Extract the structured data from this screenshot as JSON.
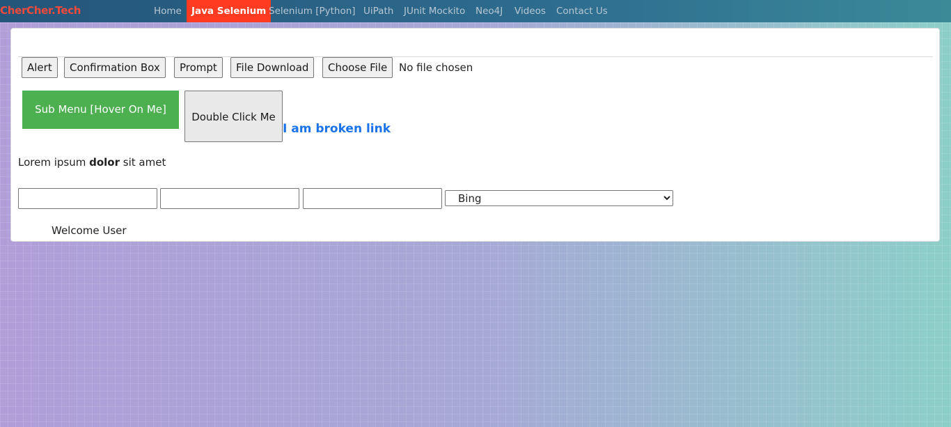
{
  "site": {
    "brand": "CherCher.Tech"
  },
  "nav": {
    "items": [
      {
        "label": "Home",
        "active": false
      },
      {
        "label": "Java Selenium",
        "active": true
      },
      {
        "label": "Selenium [Python]",
        "active": false
      },
      {
        "label": "UiPath",
        "active": false
      },
      {
        "label": "JUnit Mockito",
        "active": false
      },
      {
        "label": "Neo4J",
        "active": false
      },
      {
        "label": "Videos",
        "active": false
      },
      {
        "label": "Contact Us",
        "active": false
      }
    ]
  },
  "buttons": {
    "alert": "Alert",
    "confirmation": "Confirmation Box",
    "prompt": "Prompt",
    "file_download": "File Download",
    "choose_file": "Choose File",
    "file_status": "No file chosen"
  },
  "hover": {
    "label": "Sub Menu [Hover On Me]"
  },
  "double_click": {
    "label": "Double Click Me"
  },
  "broken_link": {
    "label": "I am broken link"
  },
  "lorem": {
    "before": "Lorem ipsum",
    "bold": "dolor",
    "after": "sit amet"
  },
  "inputs": [
    {
      "value": "",
      "placeholder": ""
    },
    {
      "value": "",
      "placeholder": ""
    },
    {
      "value": "",
      "placeholder": ""
    }
  ],
  "select": {
    "selected": "Bing"
  },
  "welcome": {
    "text": "Welcome User"
  },
  "colors": {
    "brand": "#f04a3c",
    "nav_active_bg": "#ff3b21",
    "hover_button_bg": "#4caf50",
    "link": "#1a73e8"
  }
}
